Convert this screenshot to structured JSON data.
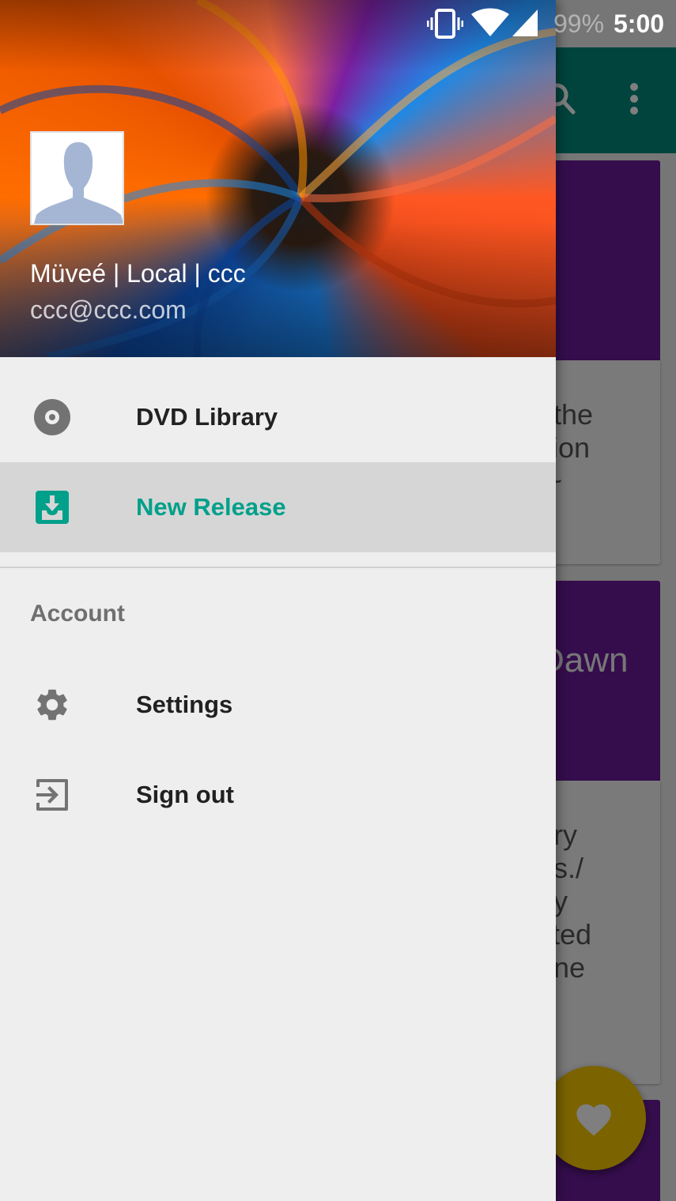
{
  "status_bar": {
    "battery": "99%",
    "time": "5:00",
    "icons": [
      "vibrate-icon",
      "wifi-icon",
      "cell-signal-icon"
    ]
  },
  "background_app": {
    "toolbar_icons": [
      "search-icon",
      "more-vert-icon"
    ],
    "cards": [
      {
        "text_fragment": "o the\nction\n. ~"
      },
      {
        "title_fragment": "Dawn",
        "text_fragment": "nry\nos./\nby\ncted\nane"
      }
    ],
    "fab_icon": "heart-icon",
    "accent_color": "#00897b",
    "card_color": "#6a1b9a",
    "fab_color": "#f6c700"
  },
  "drawer": {
    "header": {
      "avatar_icon": "default-avatar-icon",
      "account_name": "Müveé | Local | ccc",
      "account_email": "ccc@ccc.com"
    },
    "items": [
      {
        "label": "DVD Library",
        "icon": "disc-icon",
        "active": false
      },
      {
        "label": "New Release",
        "icon": "download-box-icon",
        "active": true
      }
    ],
    "section_title": "Account",
    "account_items": [
      {
        "label": "Settings",
        "icon": "gear-icon"
      },
      {
        "label": "Sign out",
        "icon": "exit-icon"
      }
    ],
    "active_color": "#00a08a"
  }
}
